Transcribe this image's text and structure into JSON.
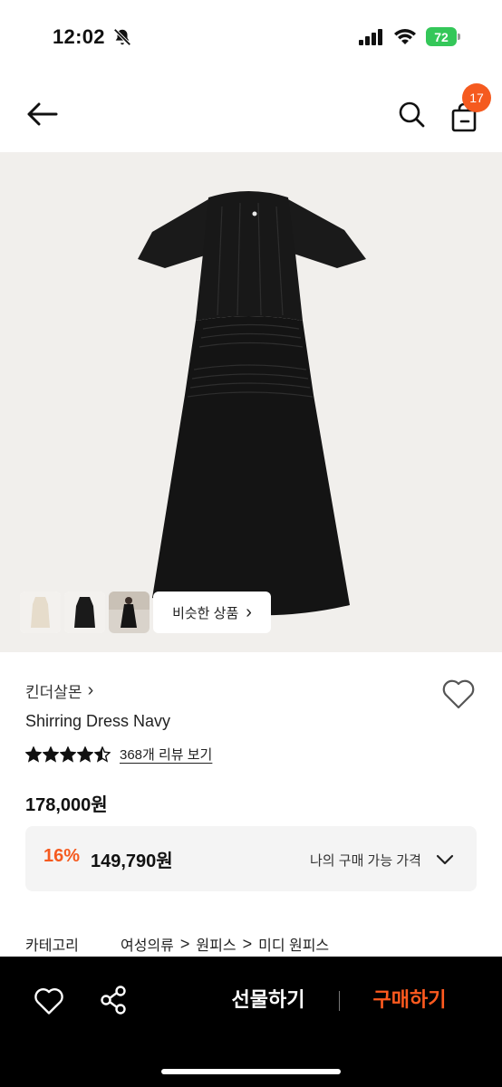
{
  "status_bar": {
    "time": "12:02",
    "battery": "72"
  },
  "nav": {
    "cart_count": "17"
  },
  "gallery": {
    "similar_label": "비슷한 상품",
    "similar_chevron": "›"
  },
  "product": {
    "brand": "킨더살몬",
    "brand_chevron": "›",
    "name": "Shirring Dress Navy",
    "rating": 4.5,
    "review_text": "368개 리뷰 보기",
    "price": "178,000원"
  },
  "my_price": {
    "discount": "16%",
    "sale_price": "149,790원",
    "label": "나의 구매 가능 가격"
  },
  "category": {
    "label": "카테고리",
    "path": [
      "여성의류",
      "원피스",
      "미디 원피스"
    ],
    "separator": ">"
  },
  "bottom_bar": {
    "gift_label": "선물하기",
    "buy_label": "구매하기"
  },
  "colors": {
    "accent": "#f55a1f",
    "battery": "#34c759",
    "image_bg": "#f1efec",
    "bottom_bar": "#000000"
  },
  "icons": [
    "bell-off-icon",
    "signal-icon",
    "wifi-icon",
    "back-arrow-icon",
    "search-icon",
    "shopping-bag-icon",
    "heart-outline-icon",
    "star-icon",
    "chevron-down-icon",
    "share-icon"
  ]
}
